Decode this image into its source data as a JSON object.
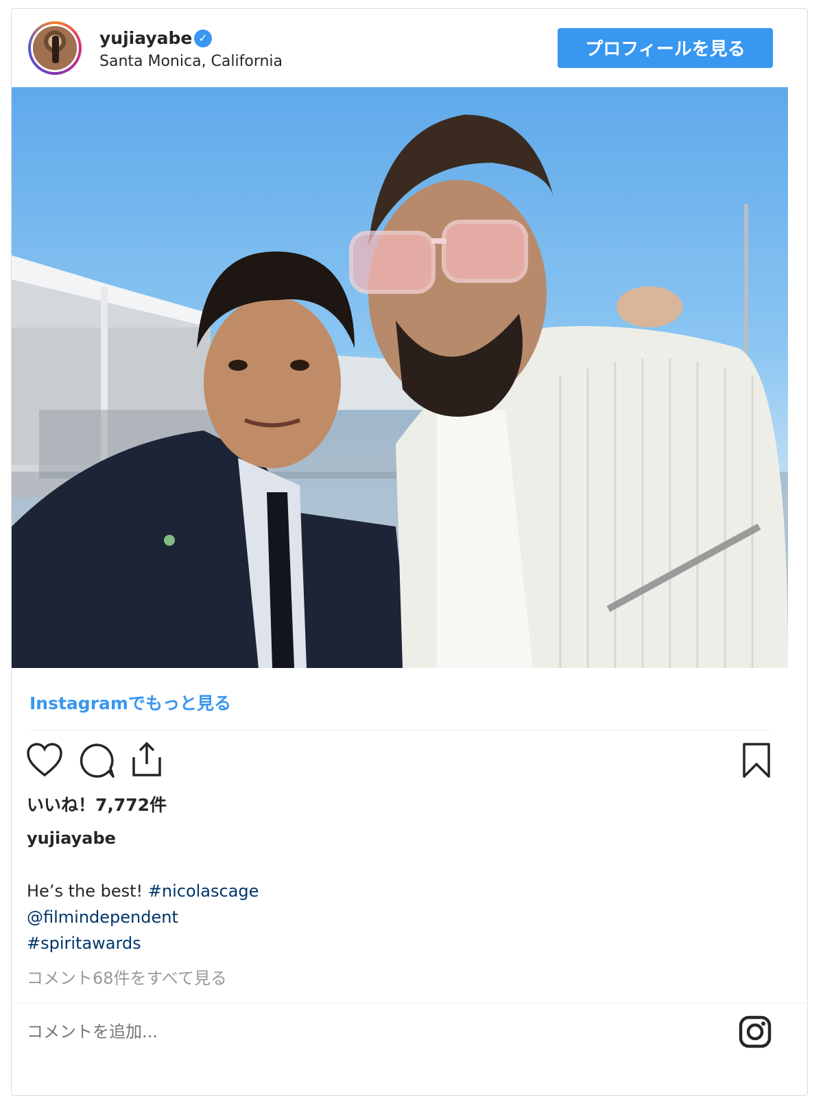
{
  "header": {
    "username": "yujiayabe",
    "location": "Santa Monica, California",
    "profile_button": "プロフィールを見る",
    "verified_icon": "verified-check-icon"
  },
  "post": {
    "more_link": "Instagramでもっと見る",
    "likes": "いいね！7,772件",
    "caption_user": "yujiayabe",
    "caption_text": "He’s the best! ",
    "tags": [
      "#nicolascage",
      "@filmindependent",
      "#spiritawards"
    ],
    "view_comments": "コメント68件をすべて見る",
    "comment_placeholder": "コメントを追加..."
  },
  "icons": [
    "heart-icon",
    "comment-icon",
    "share-icon",
    "bookmark-icon",
    "instagram-logo-icon"
  ],
  "colors": {
    "accent": "#3897f0",
    "hashtag": "#003569",
    "muted": "#999999"
  }
}
